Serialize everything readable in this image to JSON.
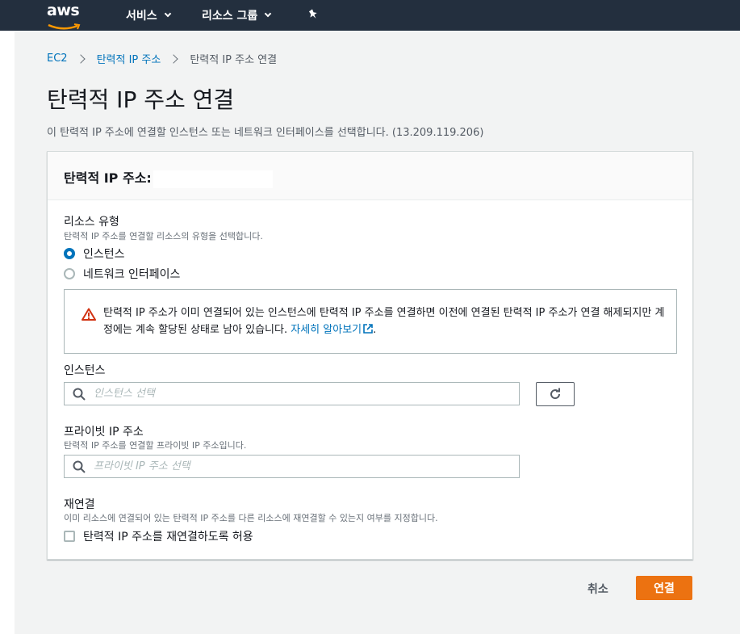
{
  "topnav": {
    "logo": "aws",
    "services_label": "서비스",
    "resource_groups_label": "리소스 그룹",
    "pin_icon": "pin-icon"
  },
  "breadcrumb": {
    "items": [
      "EC2",
      "탄력적 IP 주소",
      "탄력적 IP 주소 연결"
    ]
  },
  "page": {
    "title": "탄력적 IP 주소 연결",
    "description": "이 탄력적 IP 주소에 연결할 인스턴스 또는 네트워크 인터페이스를 선택합니다. (13.209.119.206)"
  },
  "panel": {
    "title": "탄력적 IP 주소:",
    "resource_type": {
      "label": "리소스 유형",
      "hint": "탄력적 IP 주소를 연결할 리소스의 유형을 선택합니다.",
      "options": [
        "인스턴스",
        "네트워크 인터페이스"
      ],
      "selected": "인스턴스"
    },
    "alert": {
      "text": "탄력적 IP 주소가 이미 연결되어 있는 인스턴스에 탄력적 IP 주소를 연결하면 이전에 연결된 탄력적 IP 주소가 연결 해제되지만 계정에는 계속 할당된 상태로 남아 있습니다.",
      "link": "자세히 알아보기",
      "trailing": ".",
      "icon": "warning-icon",
      "color": "#d13212"
    },
    "instance": {
      "label": "인스턴스",
      "placeholder": "인스턴스 선택",
      "value": ""
    },
    "private_ip": {
      "label": "프라이빗 IP 주소",
      "hint": "탄력적 IP 주소를 연결할 프라이빗 IP 주소입니다.",
      "placeholder": "프라이빗 IP 주소 선택",
      "value": ""
    },
    "reassociation": {
      "label": "재연결",
      "hint": "이미 리소스에 연결되어 있는 탄력적 IP 주소를 다른 리소스에 재연결할 수 있는지 여부를 지정합니다.",
      "checkbox_label": "탄력적 IP 주소를 재연결하도록 허용",
      "checked": false
    }
  },
  "actions": {
    "cancel_label": "취소",
    "submit_label": "연결"
  },
  "colors": {
    "nav_bg": "#232f3e",
    "link": "#0073bb",
    "primary": "#ec7211",
    "page_bg": "#f2f3f3"
  }
}
